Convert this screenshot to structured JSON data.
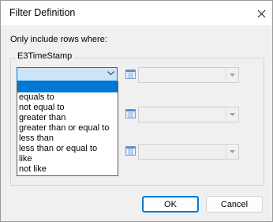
{
  "window": {
    "title": "Filter Definition"
  },
  "dialog": {
    "instruction": "Only include rows where:"
  },
  "group": {
    "label": "E3TimeStamp",
    "condition": {
      "selected_value": ""
    },
    "operator_options": [
      "equals to",
      "not equal to",
      "greater than",
      "greater than or equal to",
      "less than",
      "less than or equal to",
      "like",
      "not like"
    ]
  },
  "buttons": {
    "ok": "OK",
    "cancel": "Cancel"
  },
  "colors": {
    "accent": "#0078d7",
    "combo_fill": "#cce4f7"
  },
  "icons": [
    "close-icon",
    "chevron-down-icon",
    "calendar-icon",
    "dropdown-arrow-icon"
  ]
}
